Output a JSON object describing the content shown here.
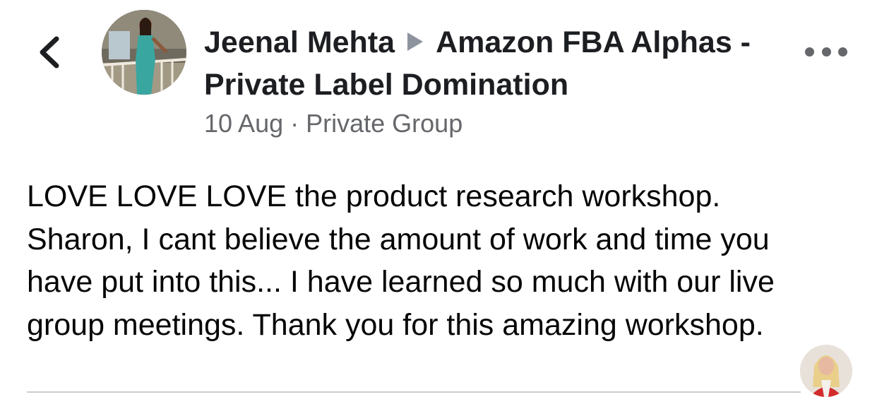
{
  "nav": {
    "back_icon": "chevron-left-icon"
  },
  "post": {
    "author": "Jeenal Mehta",
    "group": "Amazon FBA Alphas - Private Label Domination",
    "date": "10 Aug",
    "separator": "·",
    "privacy": "Private Group",
    "body_lines": [
      "LOVE LOVE LOVE the product research workshop.",
      "Sharon, I cant believe the amount of work and time you",
      "have put into this... I have learned so much with our live",
      "group meetings. Thank you for this amazing workshop."
    ],
    "more_icon": "more-horizontal-icon"
  },
  "colors": {
    "text_primary": "#1c1e21",
    "text_secondary": "#65676b",
    "arrow": "#8d949e",
    "divider": "#c9ccd1"
  }
}
